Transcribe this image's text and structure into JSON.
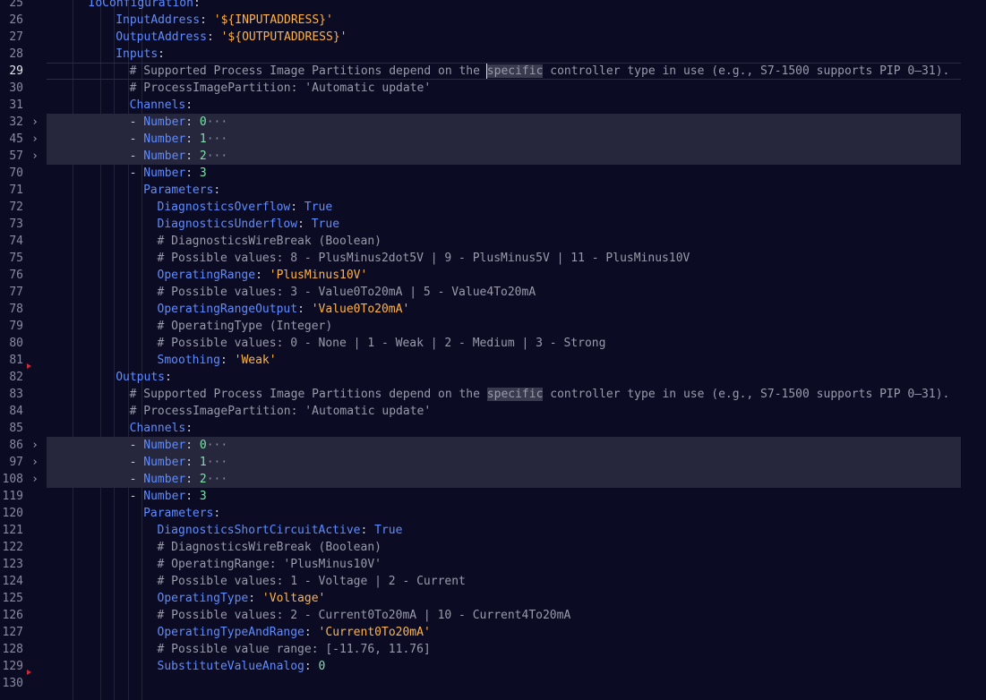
{
  "editor": {
    "lines": [
      {
        "n": "25",
        "segs": [
          {
            "t": "  ",
            "c": "p"
          },
          {
            "t": "IoConfiguration",
            "c": "k"
          },
          {
            "t": ":",
            "c": "p"
          }
        ],
        "indent": 4
      },
      {
        "n": "26",
        "segs": [
          {
            "t": "InputAddress",
            "c": "k"
          },
          {
            "t": ": ",
            "c": "p"
          },
          {
            "t": "'${INPUTADDRESS}'",
            "c": "s"
          }
        ],
        "indent": 5
      },
      {
        "n": "27",
        "segs": [
          {
            "t": "OutputAddress",
            "c": "k"
          },
          {
            "t": ": ",
            "c": "p"
          },
          {
            "t": "'${OUTPUTADDRESS}'",
            "c": "s"
          }
        ],
        "indent": 5
      },
      {
        "n": "28",
        "segs": [
          {
            "t": "Inputs",
            "c": "k"
          },
          {
            "t": ":",
            "c": "p"
          }
        ],
        "indent": 5
      },
      {
        "n": "29",
        "current": true,
        "segs": [
          {
            "t": "# Supported Process Image Partitions depend on the ",
            "c": "c"
          },
          {
            "t": "specific",
            "c": "c hl"
          },
          {
            "t": " controller type in use (e.g., S7-1500 supports PIP 0–31).",
            "c": "c"
          }
        ],
        "indent": 6
      },
      {
        "n": "30",
        "segs": [
          {
            "t": "# ProcessImagePartition: 'Automatic update'",
            "c": "c"
          }
        ],
        "indent": 6
      },
      {
        "n": "31",
        "segs": [
          {
            "t": "Channels",
            "c": "k"
          },
          {
            "t": ":",
            "c": "p"
          }
        ],
        "indent": 6
      },
      {
        "n": "32",
        "folded": true,
        "segs": [
          {
            "t": "- ",
            "c": "p"
          },
          {
            "t": "Number",
            "c": "k"
          },
          {
            "t": ": ",
            "c": "p"
          },
          {
            "t": "0",
            "c": "n"
          },
          {
            "t": "···",
            "c": "dots"
          }
        ],
        "indent": 6
      },
      {
        "n": "45",
        "folded": true,
        "segs": [
          {
            "t": "- ",
            "c": "p"
          },
          {
            "t": "Number",
            "c": "k"
          },
          {
            "t": ": ",
            "c": "p"
          },
          {
            "t": "1",
            "c": "n"
          },
          {
            "t": "···",
            "c": "dots"
          }
        ],
        "indent": 6
      },
      {
        "n": "57",
        "folded": true,
        "segs": [
          {
            "t": "- ",
            "c": "p"
          },
          {
            "t": "Number",
            "c": "k"
          },
          {
            "t": ": ",
            "c": "p"
          },
          {
            "t": "2",
            "c": "n"
          },
          {
            "t": "···",
            "c": "dots"
          }
        ],
        "indent": 6
      },
      {
        "n": "70",
        "segs": [
          {
            "t": "- ",
            "c": "p"
          },
          {
            "t": "Number",
            "c": "k"
          },
          {
            "t": ": ",
            "c": "p"
          },
          {
            "t": "3",
            "c": "n"
          }
        ],
        "indent": 6
      },
      {
        "n": "71",
        "segs": [
          {
            "t": "Parameters",
            "c": "k"
          },
          {
            "t": ":",
            "c": "p"
          }
        ],
        "indent": 7
      },
      {
        "n": "72",
        "segs": [
          {
            "t": "DiagnosticsOverflow",
            "c": "k"
          },
          {
            "t": ": ",
            "c": "p"
          },
          {
            "t": "True",
            "c": "b"
          }
        ],
        "indent": 8
      },
      {
        "n": "73",
        "segs": [
          {
            "t": "DiagnosticsUnderflow",
            "c": "k"
          },
          {
            "t": ": ",
            "c": "p"
          },
          {
            "t": "True",
            "c": "b"
          }
        ],
        "indent": 8
      },
      {
        "n": "74",
        "segs": [
          {
            "t": "# DiagnosticsWireBreak (Boolean)",
            "c": "c"
          }
        ],
        "indent": 8
      },
      {
        "n": "75",
        "segs": [
          {
            "t": "# Possible values: 8 - PlusMinus2dot5V | 9 - PlusMinus5V | 11 - PlusMinus10V",
            "c": "c"
          }
        ],
        "indent": 8
      },
      {
        "n": "76",
        "segs": [
          {
            "t": "OperatingRange",
            "c": "k"
          },
          {
            "t": ": ",
            "c": "p"
          },
          {
            "t": "'PlusMinus10V'",
            "c": "s"
          }
        ],
        "indent": 8
      },
      {
        "n": "77",
        "segs": [
          {
            "t": "# Possible values: 3 - Value0To20mA | 5 - Value4To20mA",
            "c": "c"
          }
        ],
        "indent": 8
      },
      {
        "n": "78",
        "segs": [
          {
            "t": "OperatingRangeOutput",
            "c": "k"
          },
          {
            "t": ": ",
            "c": "p"
          },
          {
            "t": "'Value0To20mA'",
            "c": "s"
          }
        ],
        "indent": 8
      },
      {
        "n": "79",
        "segs": [
          {
            "t": "# OperatingType (Integer)",
            "c": "c"
          }
        ],
        "indent": 8
      },
      {
        "n": "80",
        "segs": [
          {
            "t": "# Possible values: 0 - None | 1 - Weak | 2 - Medium | 3 - Strong",
            "c": "c"
          }
        ],
        "indent": 8
      },
      {
        "n": "81",
        "segs": [
          {
            "t": "Smoothing",
            "c": "k"
          },
          {
            "t": ": ",
            "c": "p"
          },
          {
            "t": "'Weak'",
            "c": "s"
          }
        ],
        "indent": 8
      },
      {
        "n": "82",
        "breakpoint": true,
        "segs": [
          {
            "t": "Outputs",
            "c": "k"
          },
          {
            "t": ":",
            "c": "p"
          }
        ],
        "indent": 5
      },
      {
        "n": "83",
        "segs": [
          {
            "t": "# Supported Process Image Partitions depend on the ",
            "c": "c"
          },
          {
            "t": "specific",
            "c": "c hl"
          },
          {
            "t": " controller type in use (e.g., S7-1500 supports PIP 0–31).",
            "c": "c"
          }
        ],
        "indent": 6
      },
      {
        "n": "84",
        "segs": [
          {
            "t": "# ProcessImagePartition: 'Automatic update'",
            "c": "c"
          }
        ],
        "indent": 6
      },
      {
        "n": "85",
        "segs": [
          {
            "t": "Channels",
            "c": "k"
          },
          {
            "t": ":",
            "c": "p"
          }
        ],
        "indent": 6
      },
      {
        "n": "86",
        "folded": true,
        "segs": [
          {
            "t": "- ",
            "c": "p"
          },
          {
            "t": "Number",
            "c": "k"
          },
          {
            "t": ": ",
            "c": "p"
          },
          {
            "t": "0",
            "c": "n"
          },
          {
            "t": "···",
            "c": "dots"
          }
        ],
        "indent": 6
      },
      {
        "n": "97",
        "folded": true,
        "segs": [
          {
            "t": "- ",
            "c": "p"
          },
          {
            "t": "Number",
            "c": "k"
          },
          {
            "t": ": ",
            "c": "p"
          },
          {
            "t": "1",
            "c": "n"
          },
          {
            "t": "···",
            "c": "dots"
          }
        ],
        "indent": 6
      },
      {
        "n": "108",
        "folded": true,
        "segs": [
          {
            "t": "- ",
            "c": "p"
          },
          {
            "t": "Number",
            "c": "k"
          },
          {
            "t": ": ",
            "c": "p"
          },
          {
            "t": "2",
            "c": "n"
          },
          {
            "t": "···",
            "c": "dots"
          }
        ],
        "indent": 6
      },
      {
        "n": "119",
        "segs": [
          {
            "t": "- ",
            "c": "p"
          },
          {
            "t": "Number",
            "c": "k"
          },
          {
            "t": ": ",
            "c": "p"
          },
          {
            "t": "3",
            "c": "n"
          }
        ],
        "indent": 6
      },
      {
        "n": "120",
        "segs": [
          {
            "t": "Parameters",
            "c": "k"
          },
          {
            "t": ":",
            "c": "p"
          }
        ],
        "indent": 7
      },
      {
        "n": "121",
        "segs": [
          {
            "t": "DiagnosticsShortCircuitActive",
            "c": "k"
          },
          {
            "t": ": ",
            "c": "p"
          },
          {
            "t": "True",
            "c": "b"
          }
        ],
        "indent": 8
      },
      {
        "n": "122",
        "segs": [
          {
            "t": "# DiagnosticsWireBreak (Boolean)",
            "c": "c"
          }
        ],
        "indent": 8
      },
      {
        "n": "123",
        "segs": [
          {
            "t": "# OperatingRange: 'PlusMinus10V'",
            "c": "c"
          }
        ],
        "indent": 8
      },
      {
        "n": "124",
        "segs": [
          {
            "t": "# Possible values: 1 - Voltage | 2 - Current",
            "c": "c"
          }
        ],
        "indent": 8
      },
      {
        "n": "125",
        "segs": [
          {
            "t": "OperatingType",
            "c": "k"
          },
          {
            "t": ": ",
            "c": "p"
          },
          {
            "t": "'Voltage'",
            "c": "s"
          }
        ],
        "indent": 8
      },
      {
        "n": "126",
        "segs": [
          {
            "t": "# Possible values: 2 - Current0To20mA | 10 - Current4To20mA",
            "c": "c"
          }
        ],
        "indent": 8
      },
      {
        "n": "127",
        "segs": [
          {
            "t": "OperatingTypeAndRange",
            "c": "k"
          },
          {
            "t": ": ",
            "c": "p"
          },
          {
            "t": "'Current0To20mA'",
            "c": "s"
          }
        ],
        "indent": 8
      },
      {
        "n": "128",
        "segs": [
          {
            "t": "# Possible value range: [-11.76, 11.76]",
            "c": "c"
          }
        ],
        "indent": 8
      },
      {
        "n": "129",
        "segs": [
          {
            "t": "SubstituteValueAnalog",
            "c": "k"
          },
          {
            "t": ": ",
            "c": "p"
          },
          {
            "t": "0",
            "c": "n"
          }
        ],
        "indent": 8
      },
      {
        "n": "130",
        "breakpoint": true,
        "segs": [],
        "indent": 0
      }
    ],
    "fold_icon": "chevron-right-icon",
    "colors": {
      "background": "#0b0b24",
      "key": "#5f8cff",
      "string": "#ffb347",
      "number": "#7ee2a8",
      "comment": "#9a9aab",
      "breakpoint": "#d02a3a"
    }
  }
}
